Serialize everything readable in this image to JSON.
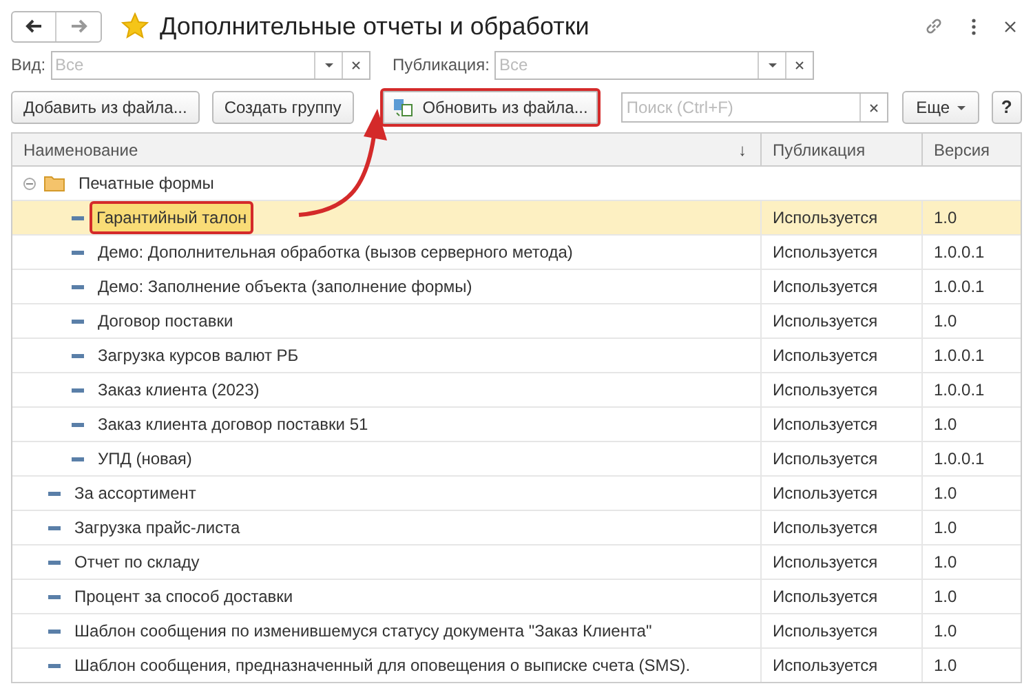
{
  "window": {
    "title": "Дополнительные отчеты и обработки",
    "favorite": true
  },
  "filters": [
    {
      "label": "Вид:",
      "placeholder": "Все"
    },
    {
      "label": "Публикация:",
      "placeholder": "Все"
    }
  ],
  "toolbar": {
    "buttons": [
      {
        "label": "Добавить из файла...",
        "highlighted": false,
        "kind": "plain"
      },
      {
        "label": "Создать группу",
        "highlighted": false,
        "kind": "plain"
      },
      {
        "label": "Обновить из файла...",
        "highlighted": true,
        "kind": "icon"
      }
    ],
    "search": {
      "placeholder": "Поиск (Ctrl+F)"
    },
    "more": "Еще",
    "help": "?"
  },
  "table": {
    "columns": [
      "Наименование",
      "Публикация",
      "Версия"
    ],
    "sort_mark": "↓",
    "rows": [
      {
        "kind": "group",
        "name": "Печатные формы",
        "expanded": true,
        "children": [
          {
            "kind": "item",
            "name": "Гарантийный талон",
            "publication": "Используется",
            "version": "1.0",
            "selected": true,
            "highlighted": true
          },
          {
            "kind": "item",
            "name": "Демо: Дополнительная обработка (вызов серверного метода)",
            "publication": "Используется",
            "version": "1.0.0.1",
            "selected": false,
            "highlighted": false
          },
          {
            "kind": "item",
            "name": "Демо: Заполнение объекта (заполнение формы)",
            "publication": "Используется",
            "version": "1.0.0.1",
            "selected": false,
            "highlighted": false
          },
          {
            "kind": "item",
            "name": "Договор поставки",
            "publication": "Используется",
            "version": "1.0",
            "selected": false,
            "highlighted": false
          },
          {
            "kind": "item",
            "name": "Загрузка курсов валют РБ",
            "publication": "Используется",
            "version": "1.0.0.1",
            "selected": false,
            "highlighted": false
          },
          {
            "kind": "item",
            "name": "Заказ клиента (2023)",
            "publication": "Используется",
            "version": "1.0.0.1",
            "selected": false,
            "highlighted": false
          },
          {
            "kind": "item",
            "name": "Заказ клиента договор поставки 51",
            "publication": "Используется",
            "version": "1.0",
            "selected": false,
            "highlighted": false
          },
          {
            "kind": "item",
            "name": "УПД (новая)",
            "publication": "Используется",
            "version": "1.0.0.1",
            "selected": false,
            "highlighted": false
          }
        ]
      },
      {
        "kind": "item",
        "name": "За ассортимент",
        "publication": "Используется",
        "version": "1.0",
        "selected": false,
        "highlighted": false
      },
      {
        "kind": "item",
        "name": "Загрузка прайс-листа",
        "publication": "Используется",
        "version": "1.0",
        "selected": false,
        "highlighted": false
      },
      {
        "kind": "item",
        "name": "Отчет по складу",
        "publication": "Используется",
        "version": "1.0",
        "selected": false,
        "highlighted": false
      },
      {
        "kind": "item",
        "name": "Процент за способ доставки",
        "publication": "Используется",
        "version": "1.0",
        "selected": false,
        "highlighted": false
      },
      {
        "kind": "item",
        "name": "Шаблон сообщения по изменившемуся статусу документа \"Заказ Клиента\"",
        "publication": "Используется",
        "version": "1.0",
        "selected": false,
        "highlighted": false
      },
      {
        "kind": "item",
        "name": "Шаблон сообщения, предназначенный для оповещения о выписке счета (SMS).",
        "publication": "Используется",
        "version": "1.0",
        "selected": false,
        "highlighted": false
      }
    ]
  }
}
